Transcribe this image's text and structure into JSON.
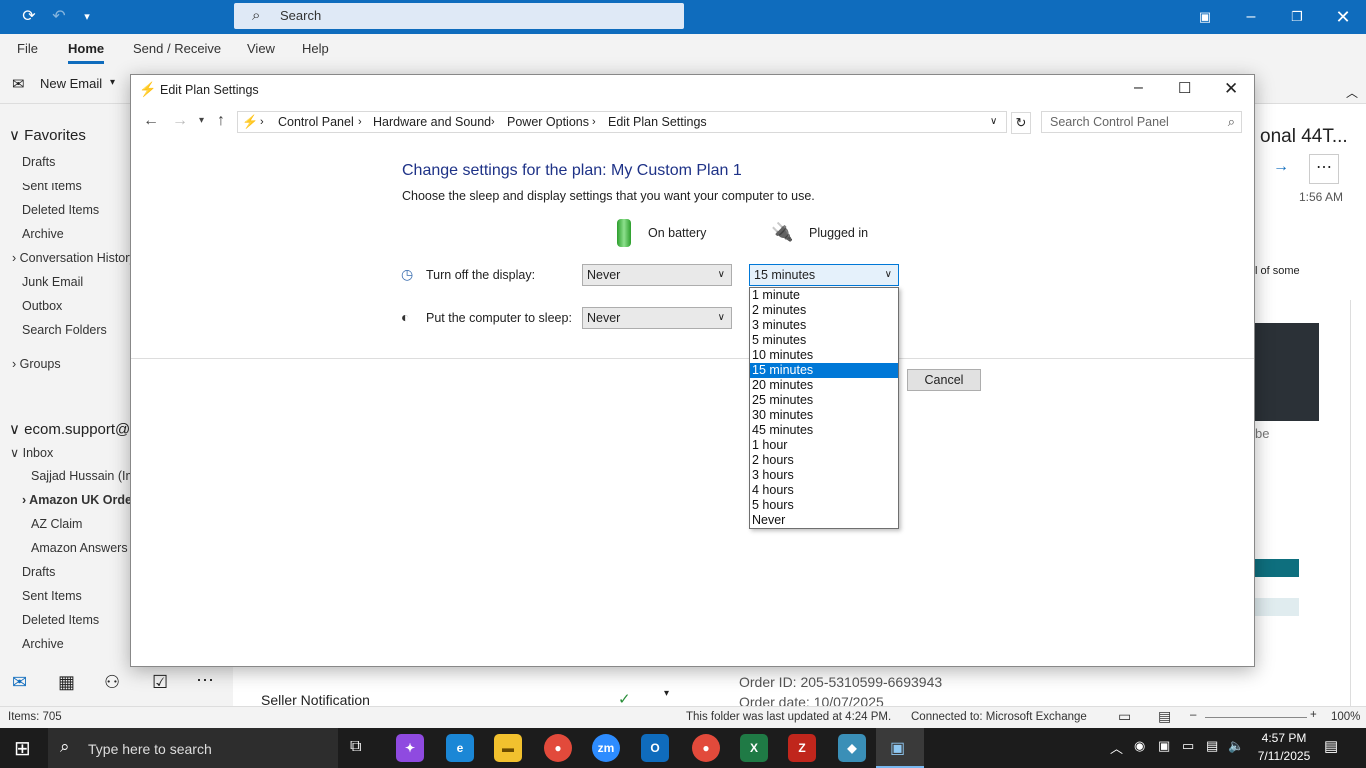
{
  "outlook": {
    "search_placeholder": "Search",
    "ribbon_tabs": [
      "File",
      "Home",
      "Send / Receive",
      "View",
      "Help"
    ],
    "new_email_label": "New Email",
    "folders": {
      "favorites_header": "Favorites",
      "favorites": [
        "Drafts",
        "Sent Items",
        "Deleted Items",
        "Archive",
        "Conversation History",
        "Junk Email",
        "Outbox",
        "Search Folders"
      ],
      "groups": "Groups",
      "account": "ecom.support@v",
      "inbox": "Inbox",
      "inbox_children": [
        "Sajjad Hussain (Imp",
        "Amazon UK Order",
        "AZ Claim",
        "Amazon Answers"
      ],
      "account_folders": [
        "Drafts",
        "Sent Items",
        "Deleted Items",
        "Archive"
      ]
    },
    "mail_list_item": "Seller Notification",
    "reading": {
      "subject_partial": "onal 44T...",
      "time": "1:56 AM",
      "snippet_partial": "l of some",
      "snippet_be": "be",
      "order_id": "Order ID: 205-5310599-6693943",
      "order_date": "Order date: 10/07/2025"
    },
    "status": {
      "items": "Items: 705",
      "updated": "This folder was last updated at 4:24 PM.",
      "connection": "Connected to: Microsoft Exchange",
      "zoom": "100%"
    }
  },
  "dialog": {
    "title": "Edit Plan Settings",
    "breadcrumb": [
      "Control Panel",
      "Hardware and Sound",
      "Power Options",
      "Edit Plan Settings"
    ],
    "search_placeholder": "Search Control Panel",
    "heading": "Change settings for the plan: My Custom Plan 1",
    "subheading": "Choose the sleep and display settings that you want your computer to use.",
    "col_battery": "On battery",
    "col_plugged": "Plugged in",
    "display_label": "Turn off the display:",
    "sleep_label": "Put the computer to sleep:",
    "display_battery": "Never",
    "display_plugged": "15 minutes",
    "sleep_battery": "Never",
    "cancel": "Cancel",
    "dropdown_options": [
      "1 minute",
      "2 minutes",
      "3 minutes",
      "5 minutes",
      "10 minutes",
      "15 minutes",
      "20 minutes",
      "25 minutes",
      "30 minutes",
      "45 minutes",
      "1 hour",
      "2 hours",
      "3 hours",
      "4 hours",
      "5 hours",
      "Never"
    ],
    "selected_option": "15 minutes"
  },
  "taskbar": {
    "search_placeholder": "Type here to search",
    "time": "4:57 PM",
    "date": "7/11/2025"
  },
  "colors": {
    "outlook_blue": "#0f6cbd",
    "selection": "#0078d7",
    "heading": "#1e3287"
  }
}
